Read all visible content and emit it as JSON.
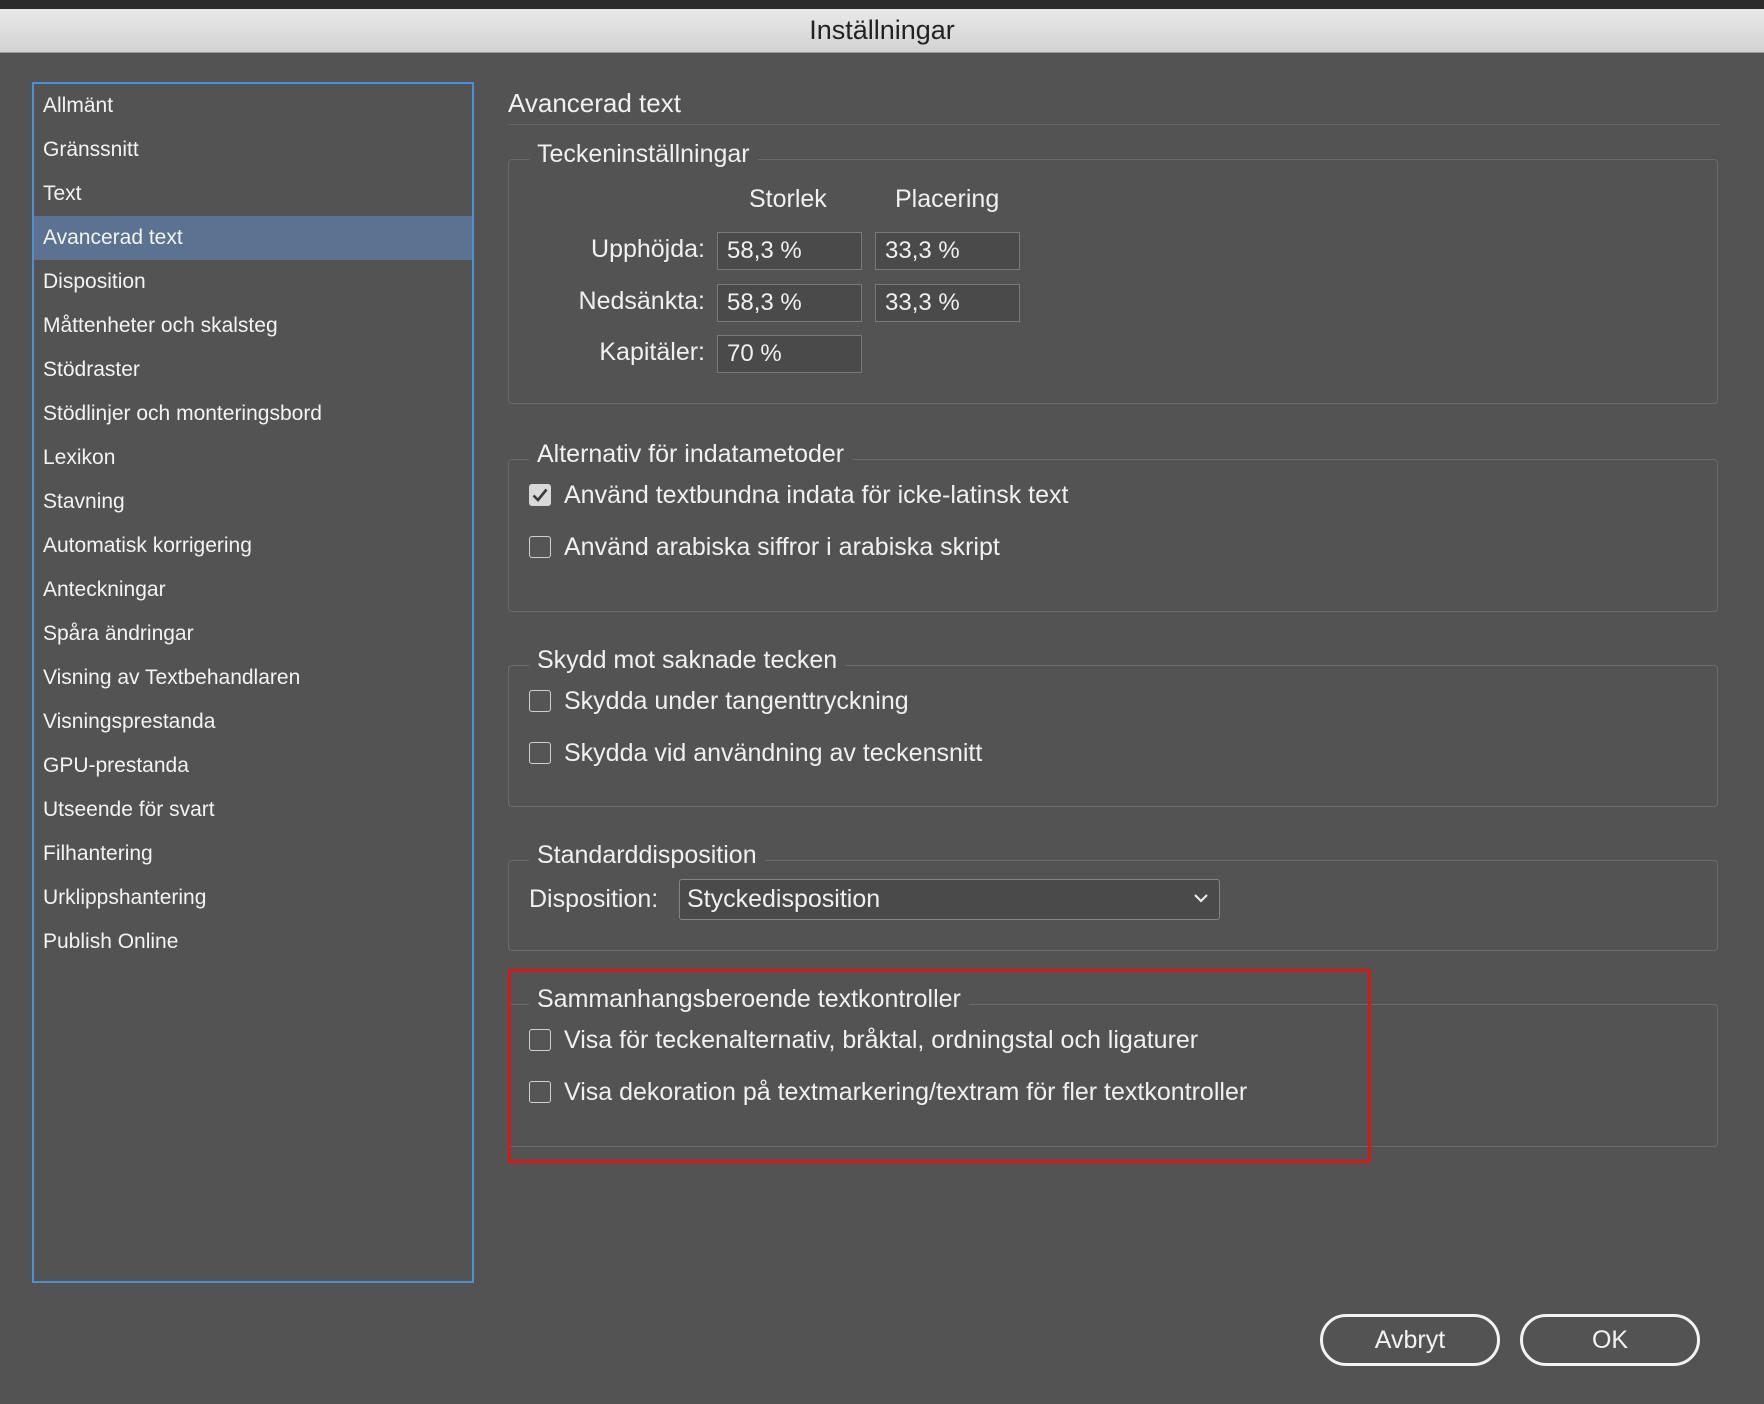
{
  "window": {
    "title": "Inställningar"
  },
  "sidebar": {
    "items": [
      {
        "label": "Allmänt"
      },
      {
        "label": "Gränssnitt"
      },
      {
        "label": "Text"
      },
      {
        "label": "Avancerad text",
        "selected": true
      },
      {
        "label": "Disposition"
      },
      {
        "label": "Måttenheter och skalsteg"
      },
      {
        "label": "Stödraster"
      },
      {
        "label": "Stödlinjer och monteringsbord"
      },
      {
        "label": "Lexikon"
      },
      {
        "label": "Stavning"
      },
      {
        "label": "Automatisk korrigering"
      },
      {
        "label": "Anteckningar"
      },
      {
        "label": "Spåra ändringar"
      },
      {
        "label": "Visning av Textbehandlaren"
      },
      {
        "label": "Visningsprestanda"
      },
      {
        "label": "GPU-prestanda"
      },
      {
        "label": "Utseende för svart"
      },
      {
        "label": "Filhantering"
      },
      {
        "label": "Urklippshantering"
      },
      {
        "label": "Publish Online"
      }
    ]
  },
  "main": {
    "title": "Avancerad text",
    "character_settings": {
      "legend": "Teckeninställningar",
      "col_size": "Storlek",
      "col_position": "Placering",
      "superscript_label": "Upphöjda:",
      "superscript_size": "58,3 %",
      "superscript_position": "33,3 %",
      "subscript_label": "Nedsänkta:",
      "subscript_size": "58,3 %",
      "subscript_position": "33,3 %",
      "smallcaps_label": "Kapitäler:",
      "smallcaps_size": "70 %"
    },
    "input_method": {
      "legend": "Alternativ för indatametoder",
      "inline_input": {
        "label": "Använd textbundna indata för icke-latinsk text",
        "checked": true
      },
      "arabic_digits": {
        "label": "Använd arabiska siffror i arabiska skript",
        "checked": false
      }
    },
    "missing_glyph": {
      "legend": "Skydd mot saknade tecken",
      "protect_typing": {
        "label": "Skydda under tangenttryckning",
        "checked": false
      },
      "protect_font": {
        "label": "Skydda vid användning av teckensnitt",
        "checked": false
      }
    },
    "default_composer": {
      "legend": "Standarddisposition",
      "composer_label": "Disposition:",
      "composer_value": "Styckedisposition"
    },
    "contextual_controls": {
      "legend": "Sammanhangsberoende textkontroller",
      "show_alternates": {
        "label": "Visa för teckenalternativ, bråktal, ordningstal och ligaturer",
        "checked": false
      },
      "show_decoration": {
        "label": "Visa dekoration på textmarkering/textram för fler textkontroller",
        "checked": false
      }
    }
  },
  "buttons": {
    "cancel": "Avbryt",
    "ok": "OK"
  },
  "colors": {
    "highlight": "#d6181c",
    "selection": "#5b7291",
    "sidebar_border": "#4a90d9"
  }
}
